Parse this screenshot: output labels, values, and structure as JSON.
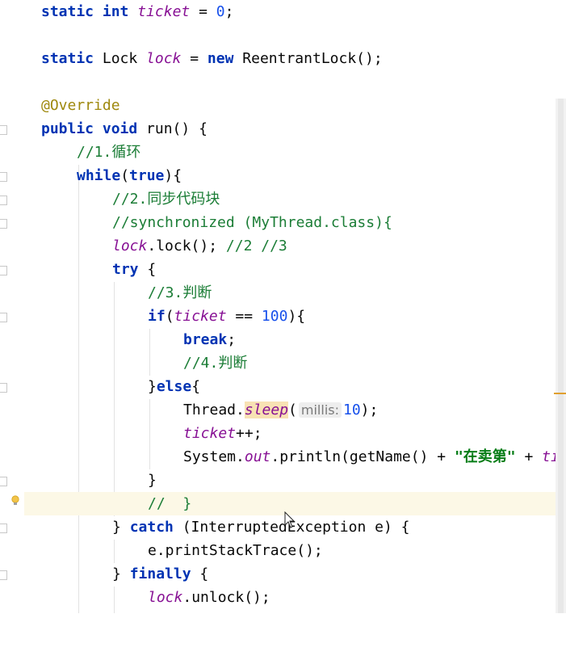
{
  "editor": {
    "lines": {
      "l1": {
        "kw1": "static int ",
        "fld": "ticket",
        "rest": " = ",
        "num": "0",
        "end": ";"
      },
      "l2": {
        "kw1": "static ",
        "plain": "Lock ",
        "fld": "lock",
        "eq": " = ",
        "kw2": "new ",
        "rest": "ReentrantLock();"
      },
      "l3": {
        "ann": "@Override"
      },
      "l4": {
        "kw1": "public void ",
        "rest": "run() {"
      },
      "l5": {
        "cm": "//1.循环"
      },
      "l6": {
        "kw1": "while",
        "p1": "(",
        "kw2": "true",
        "p2": "){"
      },
      "l7": {
        "cm": "//2.同步代码块"
      },
      "l8": {
        "cm": "//synchronized (MyThread.class){"
      },
      "l9": {
        "fld": "lock",
        "rest": ".lock(); ",
        "cm": "//2 //3"
      },
      "l10": {
        "kw1": "try",
        "rest": " {"
      },
      "l11": {
        "cm": "//3.判断"
      },
      "l12": {
        "kw1": "if",
        "p1": "(",
        "fld": "ticket",
        "op": " == ",
        "num": "100",
        "p2": "){"
      },
      "l13": {
        "kw1": "break",
        "rest": ";"
      },
      "l14": {
        "cm": "//4.判断"
      },
      "l15": {
        "p1": "}",
        "kw1": "else",
        "p2": "{"
      },
      "l16": {
        "p1": "Thread.",
        "fld": "sleep",
        "p2": "(",
        "hint": "millis:",
        "num": "10",
        "p3": ");"
      },
      "l17": {
        "fld": "ticket",
        "rest": "++;"
      },
      "l18": {
        "p1": "System.",
        "fld": "out",
        "p2": ".println(getName() + ",
        "str": "\"在卖第\"",
        "p3": " + ",
        "fld2": "ti"
      },
      "l19": {
        "p1": "}"
      },
      "l20": {
        "cm": "//  }"
      },
      "l21": {
        "p1": "} ",
        "kw1": "catch",
        "p2": " (InterruptedException e) {"
      },
      "l22": {
        "p1": "e.printStackTrace();"
      },
      "l23": {
        "p1": "} ",
        "kw1": "finally",
        "p2": " {"
      },
      "l24": {
        "fld": "lock",
        "p1": ".unlock();"
      }
    }
  },
  "colors": {
    "keyword": "#0033b3",
    "field": "#871094",
    "comment": "#1b7d36",
    "annotation": "#9e880d",
    "number": "#1750eb",
    "string": "#067d17",
    "current_line": "#fcf8e6"
  },
  "icons": [
    "fold-marker-icon",
    "intention-bulb-icon",
    "mouse-cursor-icon"
  ]
}
